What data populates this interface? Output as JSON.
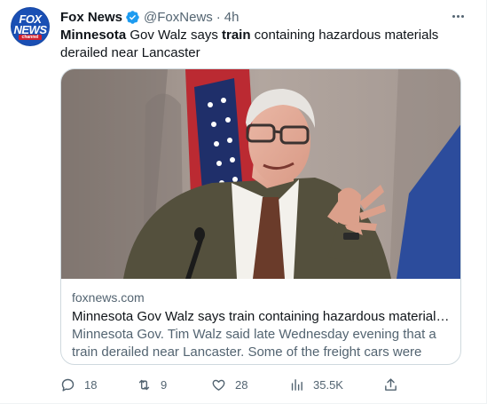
{
  "author": {
    "display_name": "Fox News",
    "handle": "@FoxNews",
    "separator": "·",
    "time": "4h",
    "verified": true,
    "avatar_logo": {
      "line1": "FOX",
      "line2": "NEWS",
      "line3": "channel"
    }
  },
  "tweet": {
    "segments": [
      {
        "text": "Minnesota",
        "bold": true
      },
      {
        "text": " Gov Walz says ",
        "bold": false
      },
      {
        "text": "train",
        "bold": true
      },
      {
        "text": " containing hazardous materials derailed near Lancaster",
        "bold": false
      }
    ]
  },
  "card": {
    "image_description": "photo",
    "domain": "foxnews.com",
    "title": "Minnesota Gov Walz says train containing hazardous materials derai...",
    "description": "Minnesota Gov. Tim Walz said late Wednesday evening that a train derailed near Lancaster. Some of the freight cars were reportedly ..."
  },
  "actions": {
    "replies": {
      "icon": "reply-icon",
      "count": "18"
    },
    "retweets": {
      "icon": "retweet-icon",
      "count": "9"
    },
    "likes": {
      "icon": "heart-icon",
      "count": "28"
    },
    "views": {
      "icon": "views-icon",
      "count": "35.5K"
    },
    "share": {
      "icon": "share-icon"
    }
  },
  "colors": {
    "text_primary": "#0f1419",
    "text_secondary": "#536471",
    "verified_blue": "#1d9bf0",
    "border": "#cfd9de",
    "avatar_blue": "#1a4fb4",
    "avatar_red": "#d0202e"
  }
}
